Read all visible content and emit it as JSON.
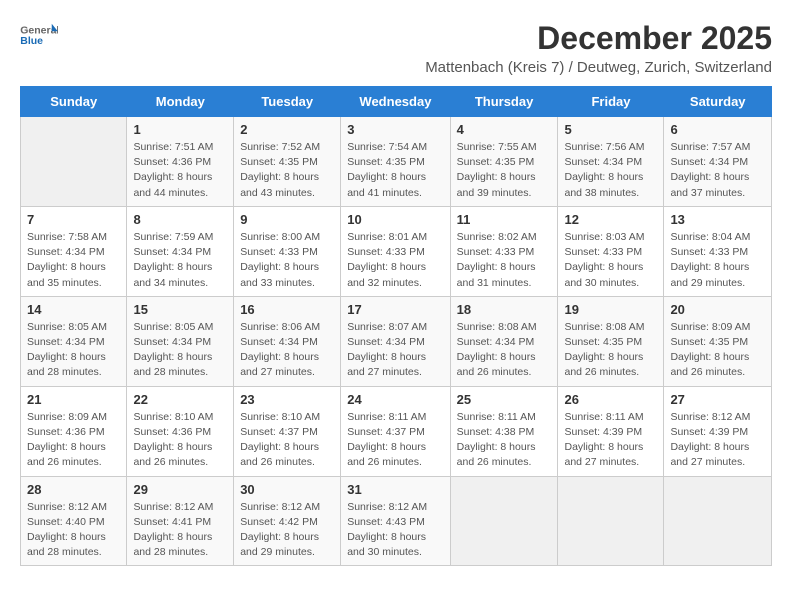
{
  "header": {
    "logo_general": "General",
    "logo_blue": "Blue",
    "month_title": "December 2025",
    "subtitle": "Mattenbach (Kreis 7) / Deutweg, Zurich, Switzerland"
  },
  "days_of_week": [
    "Sunday",
    "Monday",
    "Tuesday",
    "Wednesday",
    "Thursday",
    "Friday",
    "Saturday"
  ],
  "weeks": [
    [
      {
        "day": "",
        "info": ""
      },
      {
        "day": "1",
        "info": "Sunrise: 7:51 AM\nSunset: 4:36 PM\nDaylight: 8 hours\nand 44 minutes."
      },
      {
        "day": "2",
        "info": "Sunrise: 7:52 AM\nSunset: 4:35 PM\nDaylight: 8 hours\nand 43 minutes."
      },
      {
        "day": "3",
        "info": "Sunrise: 7:54 AM\nSunset: 4:35 PM\nDaylight: 8 hours\nand 41 minutes."
      },
      {
        "day": "4",
        "info": "Sunrise: 7:55 AM\nSunset: 4:35 PM\nDaylight: 8 hours\nand 39 minutes."
      },
      {
        "day": "5",
        "info": "Sunrise: 7:56 AM\nSunset: 4:34 PM\nDaylight: 8 hours\nand 38 minutes."
      },
      {
        "day": "6",
        "info": "Sunrise: 7:57 AM\nSunset: 4:34 PM\nDaylight: 8 hours\nand 37 minutes."
      }
    ],
    [
      {
        "day": "7",
        "info": "Sunrise: 7:58 AM\nSunset: 4:34 PM\nDaylight: 8 hours\nand 35 minutes."
      },
      {
        "day": "8",
        "info": "Sunrise: 7:59 AM\nSunset: 4:34 PM\nDaylight: 8 hours\nand 34 minutes."
      },
      {
        "day": "9",
        "info": "Sunrise: 8:00 AM\nSunset: 4:33 PM\nDaylight: 8 hours\nand 33 minutes."
      },
      {
        "day": "10",
        "info": "Sunrise: 8:01 AM\nSunset: 4:33 PM\nDaylight: 8 hours\nand 32 minutes."
      },
      {
        "day": "11",
        "info": "Sunrise: 8:02 AM\nSunset: 4:33 PM\nDaylight: 8 hours\nand 31 minutes."
      },
      {
        "day": "12",
        "info": "Sunrise: 8:03 AM\nSunset: 4:33 PM\nDaylight: 8 hours\nand 30 minutes."
      },
      {
        "day": "13",
        "info": "Sunrise: 8:04 AM\nSunset: 4:33 PM\nDaylight: 8 hours\nand 29 minutes."
      }
    ],
    [
      {
        "day": "14",
        "info": "Sunrise: 8:05 AM\nSunset: 4:34 PM\nDaylight: 8 hours\nand 28 minutes."
      },
      {
        "day": "15",
        "info": "Sunrise: 8:05 AM\nSunset: 4:34 PM\nDaylight: 8 hours\nand 28 minutes."
      },
      {
        "day": "16",
        "info": "Sunrise: 8:06 AM\nSunset: 4:34 PM\nDaylight: 8 hours\nand 27 minutes."
      },
      {
        "day": "17",
        "info": "Sunrise: 8:07 AM\nSunset: 4:34 PM\nDaylight: 8 hours\nand 27 minutes."
      },
      {
        "day": "18",
        "info": "Sunrise: 8:08 AM\nSunset: 4:34 PM\nDaylight: 8 hours\nand 26 minutes."
      },
      {
        "day": "19",
        "info": "Sunrise: 8:08 AM\nSunset: 4:35 PM\nDaylight: 8 hours\nand 26 minutes."
      },
      {
        "day": "20",
        "info": "Sunrise: 8:09 AM\nSunset: 4:35 PM\nDaylight: 8 hours\nand 26 minutes."
      }
    ],
    [
      {
        "day": "21",
        "info": "Sunrise: 8:09 AM\nSunset: 4:36 PM\nDaylight: 8 hours\nand 26 minutes."
      },
      {
        "day": "22",
        "info": "Sunrise: 8:10 AM\nSunset: 4:36 PM\nDaylight: 8 hours\nand 26 minutes."
      },
      {
        "day": "23",
        "info": "Sunrise: 8:10 AM\nSunset: 4:37 PM\nDaylight: 8 hours\nand 26 minutes."
      },
      {
        "day": "24",
        "info": "Sunrise: 8:11 AM\nSunset: 4:37 PM\nDaylight: 8 hours\nand 26 minutes."
      },
      {
        "day": "25",
        "info": "Sunrise: 8:11 AM\nSunset: 4:38 PM\nDaylight: 8 hours\nand 26 minutes."
      },
      {
        "day": "26",
        "info": "Sunrise: 8:11 AM\nSunset: 4:39 PM\nDaylight: 8 hours\nand 27 minutes."
      },
      {
        "day": "27",
        "info": "Sunrise: 8:12 AM\nSunset: 4:39 PM\nDaylight: 8 hours\nand 27 minutes."
      }
    ],
    [
      {
        "day": "28",
        "info": "Sunrise: 8:12 AM\nSunset: 4:40 PM\nDaylight: 8 hours\nand 28 minutes."
      },
      {
        "day": "29",
        "info": "Sunrise: 8:12 AM\nSunset: 4:41 PM\nDaylight: 8 hours\nand 28 minutes."
      },
      {
        "day": "30",
        "info": "Sunrise: 8:12 AM\nSunset: 4:42 PM\nDaylight: 8 hours\nand 29 minutes."
      },
      {
        "day": "31",
        "info": "Sunrise: 8:12 AM\nSunset: 4:43 PM\nDaylight: 8 hours\nand 30 minutes."
      },
      {
        "day": "",
        "info": ""
      },
      {
        "day": "",
        "info": ""
      },
      {
        "day": "",
        "info": ""
      }
    ]
  ]
}
